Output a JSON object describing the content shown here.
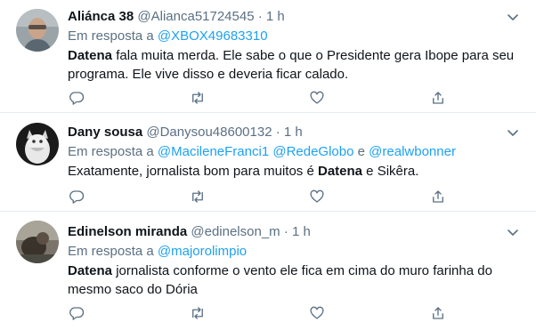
{
  "tweets": [
    {
      "name": "Aliánca 38",
      "handle": "@Alianca51724545",
      "sep": "·",
      "time": "1 h",
      "reply_prefix": "Em resposta a",
      "mentions": [
        "@XBOX49683310"
      ],
      "text_bold": "Datena",
      "text_rest": " fala muita merda. Ele sabe o que o Presidente gera Ibope para seu programa. Ele vive disso e deveria ficar calado."
    },
    {
      "name": "Dany sousa",
      "handle": "@Danysou48600132",
      "sep": "·",
      "time": "1 h",
      "reply_prefix": "Em resposta a",
      "mentions": [
        "@MacileneFranci1",
        "@RedeGlobo",
        "@realwbonner"
      ],
      "mention_joiner": " e ",
      "text_pre": "Exatamente, jornalista bom para muitos é ",
      "text_bold": "Datena",
      "text_post": " e Sikêra."
    },
    {
      "name": "Edinelson miranda",
      "handle": "@edinelson_m",
      "sep": "·",
      "time": "1 h",
      "reply_prefix": "Em resposta a",
      "mentions": [
        "@majorolimpio"
      ],
      "text_bold": "Datena",
      "text_rest": " jornalista conforme o vento ele fica em cima do muro farinha do mesmo saco do Dória"
    }
  ],
  "icons": [
    "chevron-down-icon",
    "reply-icon",
    "retweet-icon",
    "like-icon",
    "share-icon"
  ],
  "colors": {
    "accent": "#1da1f2",
    "muted": "#5b7083",
    "text": "#0f1419",
    "divider": "#e6ecf0"
  }
}
